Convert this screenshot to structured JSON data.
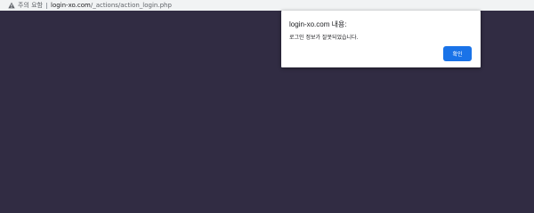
{
  "addressbar": {
    "security_label": "주의 요함",
    "url_host": "login-xo.com",
    "url_path": "/_actions/action_login.php",
    "warning_icon": "warning-triangle"
  },
  "page": {
    "background_color": "#312c43"
  },
  "dialog": {
    "title": "login-xo.com 내용:",
    "message": "로그인 정보가 잘못되었습니다.",
    "ok_label": "확인",
    "button_color": "#1a73e8"
  }
}
